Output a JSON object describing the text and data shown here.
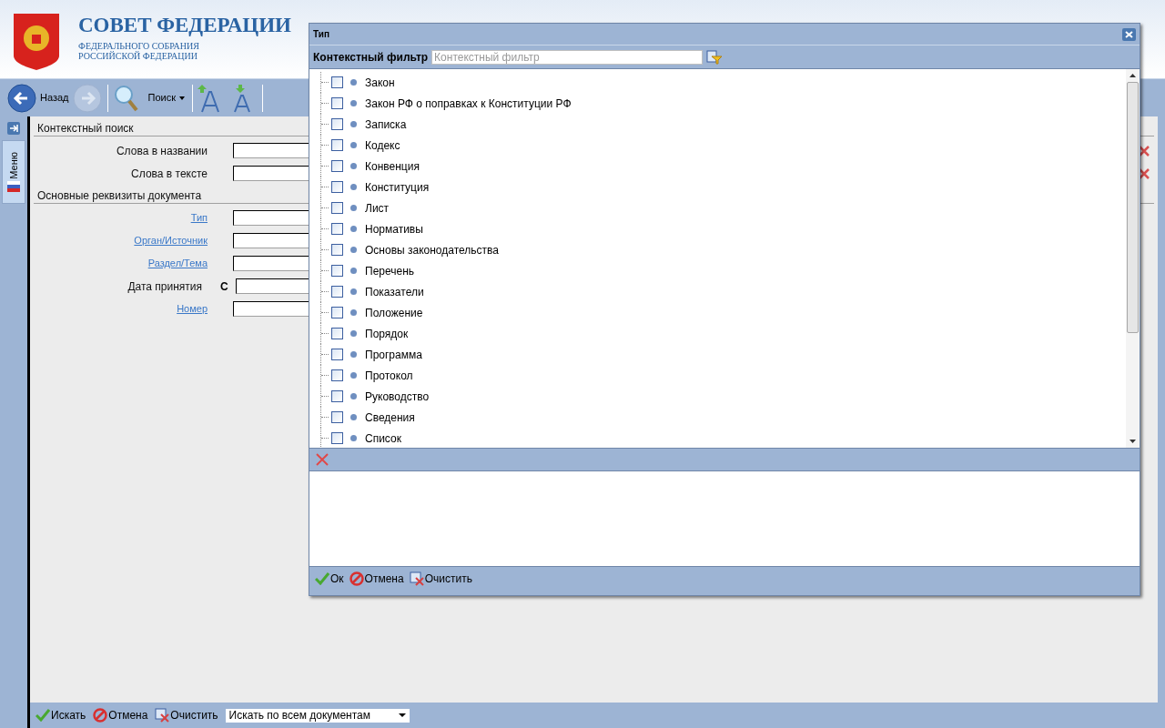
{
  "header": {
    "title": "СОВЕТ ФЕДЕРАЦИИ",
    "subtitle_lines": [
      "ФЕДЕРАЛЬНОГО СОБРАНИЯ",
      "РОССИЙСКОЙ ФЕДЕРАЦИИ"
    ]
  },
  "toolbar": {
    "back_label": "Назад",
    "search_label": "Поиск"
  },
  "side_tab": {
    "label": "Меню"
  },
  "form": {
    "sections": [
      {
        "title": "Контекстный поиск",
        "rows": [
          {
            "kind": "text",
            "label": "Слова в названии",
            "link": false,
            "clearable": true
          },
          {
            "kind": "text",
            "label": "Слова в тексте",
            "link": false,
            "clearable": true
          }
        ]
      },
      {
        "title": "Основные реквизиты документа",
        "rows": [
          {
            "kind": "text",
            "label": "Тип",
            "link": true,
            "clearable": false
          },
          {
            "kind": "text",
            "label": "Орган/Источник",
            "link": true,
            "clearable": false
          },
          {
            "kind": "text",
            "label": "Раздел/Тема",
            "link": true,
            "clearable": false
          },
          {
            "kind": "date",
            "label": "Дата принятия",
            "link": false,
            "prefix": "С",
            "clearable": false
          },
          {
            "kind": "text",
            "label": "Номер",
            "link": true,
            "clearable": false
          }
        ]
      }
    ]
  },
  "bottom_bar": {
    "buttons": [
      {
        "kind": "ok",
        "label": "Искать"
      },
      {
        "kind": "cancel",
        "label": "Отмена"
      },
      {
        "kind": "clear",
        "label": "Очистить"
      }
    ],
    "scope_select": "Искать по всем документам"
  },
  "dialog": {
    "title": "Тип",
    "filter_label": "Контекстный фильтр",
    "filter_placeholder": "Контекстный фильтр",
    "items": [
      {
        "label": "Закон",
        "checked": false
      },
      {
        "label": "Закон РФ о поправках к Конституции РФ",
        "checked": false
      },
      {
        "label": "Записка",
        "checked": false
      },
      {
        "label": "Кодекс",
        "checked": false
      },
      {
        "label": "Конвенция",
        "checked": false
      },
      {
        "label": "Конституция",
        "checked": false
      },
      {
        "label": "Лист",
        "checked": false
      },
      {
        "label": "Нормативы",
        "checked": false
      },
      {
        "label": "Основы законодательства",
        "checked": false
      },
      {
        "label": "Перечень",
        "checked": false
      },
      {
        "label": "Показатели",
        "checked": false
      },
      {
        "label": "Положение",
        "checked": false
      },
      {
        "label": "Порядок",
        "checked": false
      },
      {
        "label": "Программа",
        "checked": false
      },
      {
        "label": "Протокол",
        "checked": false
      },
      {
        "label": "Руководство",
        "checked": false
      },
      {
        "label": "Сведения",
        "checked": false
      },
      {
        "label": "Список",
        "checked": false
      }
    ],
    "buttons": [
      {
        "kind": "ok",
        "label": "Ок"
      },
      {
        "kind": "cancel",
        "label": "Отмена"
      },
      {
        "kind": "clear",
        "label": "Очистить"
      }
    ]
  }
}
